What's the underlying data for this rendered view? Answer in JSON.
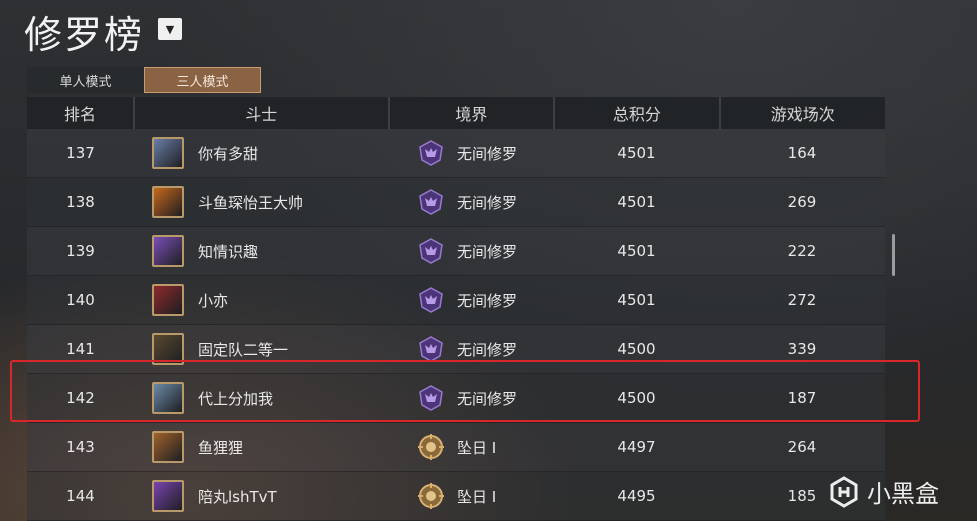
{
  "title": "修罗榜",
  "tabs": [
    {
      "label": "单人模式",
      "active": false
    },
    {
      "label": "三人模式",
      "active": true
    }
  ],
  "columns": [
    "排名",
    "斗士",
    "境界",
    "总积分",
    "游戏场次"
  ],
  "rows": [
    {
      "rank": "137",
      "name": "你有多甜",
      "tier": "无间修罗",
      "score": "4501",
      "games": "164",
      "avatar_color": "#6a7fa8",
      "tier_icon": "purple-demon-icon"
    },
    {
      "rank": "138",
      "name": "斗鱼琛怡王大帅",
      "tier": "无间修罗",
      "score": "4501",
      "games": "269",
      "avatar_color": "#c8681c",
      "tier_icon": "purple-demon-icon"
    },
    {
      "rank": "139",
      "name": "知情识趣",
      "tier": "无间修罗",
      "score": "4501",
      "games": "222",
      "avatar_color": "#7a4fb8",
      "tier_icon": "purple-demon-icon"
    },
    {
      "rank": "140",
      "name": "小亦",
      "tier": "无间修罗",
      "score": "4501",
      "games": "272",
      "avatar_color": "#8e2a2c",
      "tier_icon": "purple-demon-icon"
    },
    {
      "rank": "141",
      "name": "固定队二等一",
      "tier": "无间修罗",
      "score": "4500",
      "games": "339",
      "avatar_color": "#5a4a30",
      "tier_icon": "purple-demon-icon"
    },
    {
      "rank": "142",
      "name": "代上分加我",
      "tier": "无间修罗",
      "score": "4500",
      "games": "187",
      "avatar_color": "#6c8aa8",
      "tier_icon": "purple-demon-icon"
    },
    {
      "rank": "143",
      "name": "鱼狸狸",
      "tier": "坠日 I",
      "score": "4497",
      "games": "264",
      "avatar_color": "#a0622c",
      "tier_icon": "golden-sun-icon"
    },
    {
      "rank": "144",
      "name": "陪丸lshTvT",
      "tier": "坠日 I",
      "score": "4495",
      "games": "185",
      "avatar_color": "#7a44b0",
      "tier_icon": "golden-sun-icon"
    }
  ],
  "watermark": "小黑盒",
  "colors": {
    "highlight": "#d9262b",
    "active_tab": "#8a6244",
    "tier_purple": "#6b4aa8",
    "tier_gold": "#b38a4a"
  }
}
